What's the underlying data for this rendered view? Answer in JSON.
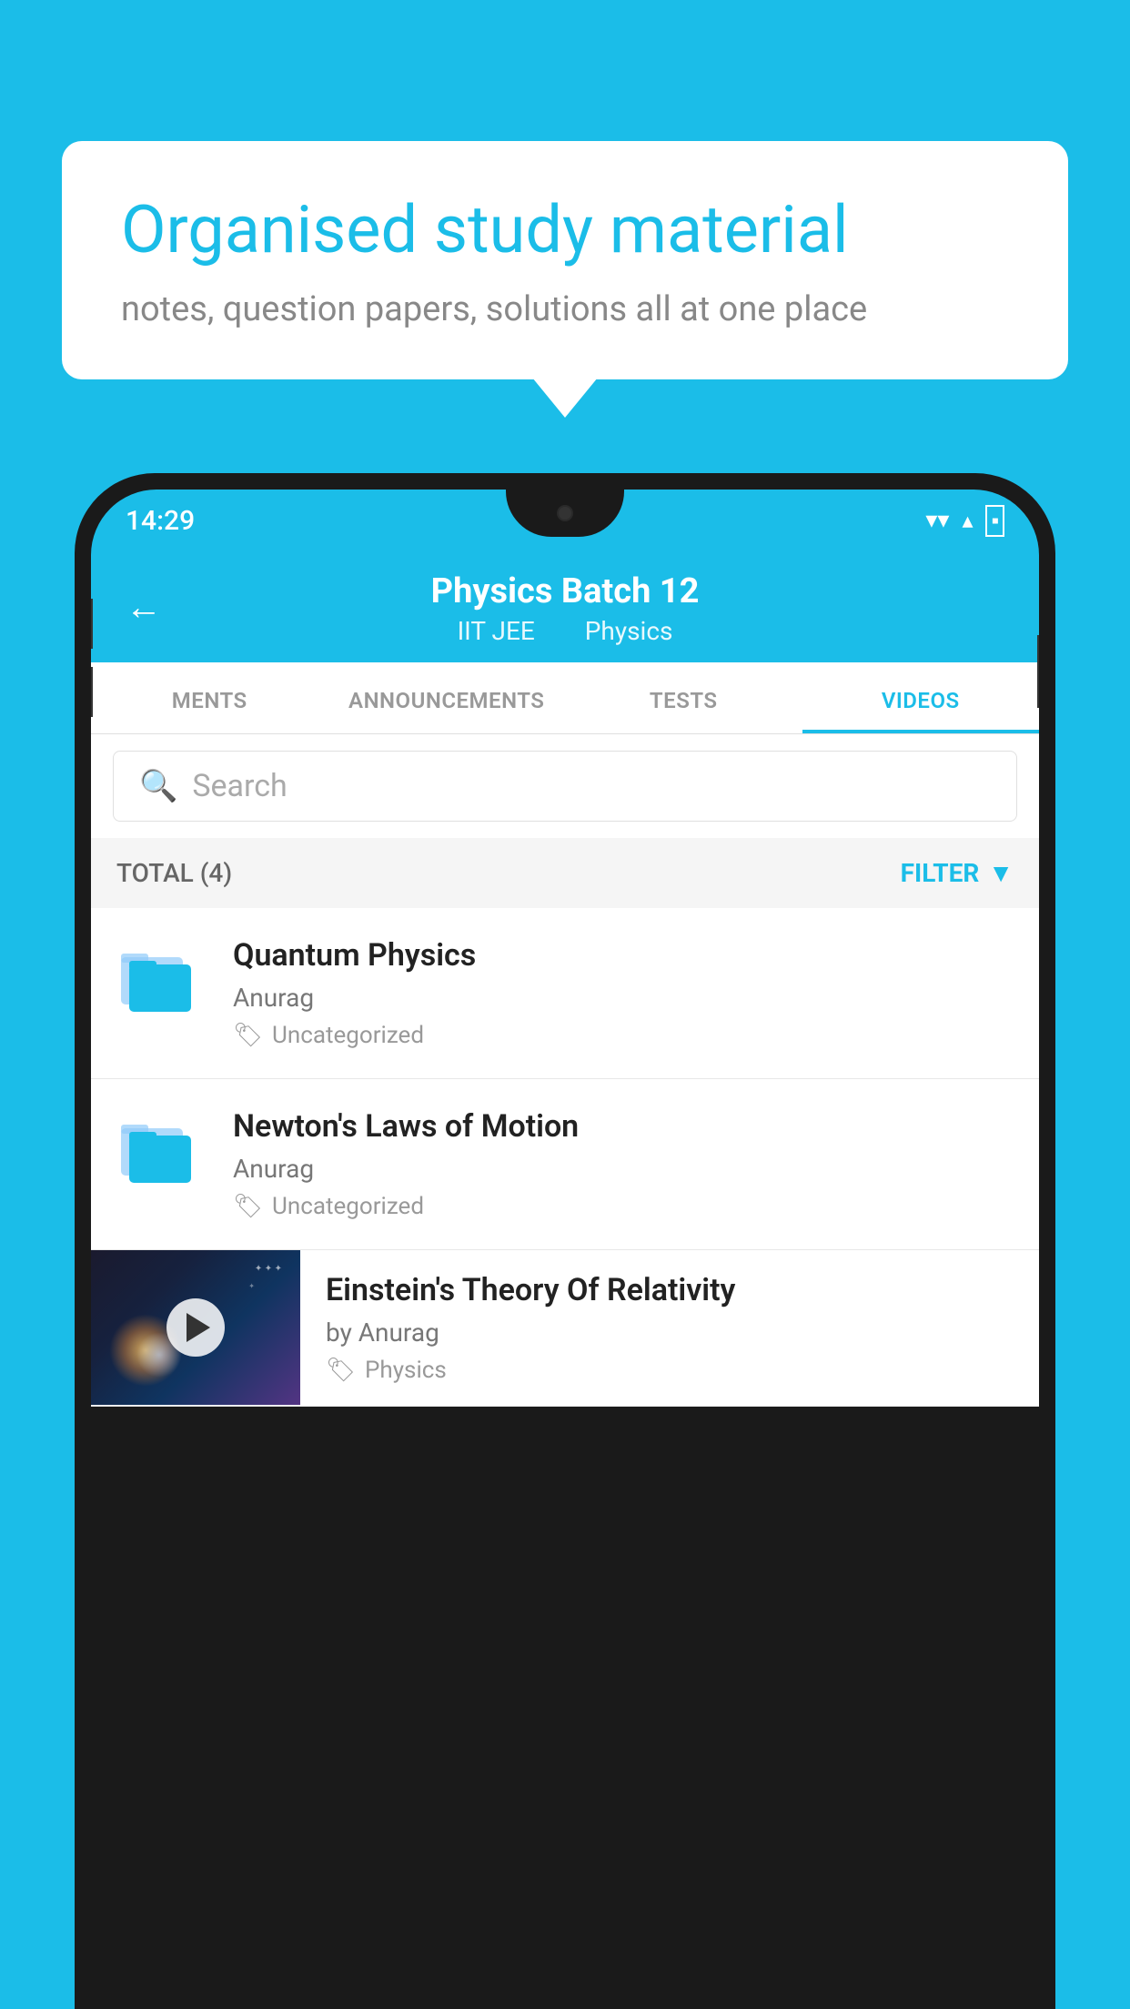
{
  "background_color": "#1BBDE8",
  "speech_bubble": {
    "title": "Organised study material",
    "subtitle": "notes, question papers, solutions all at one place"
  },
  "status_bar": {
    "time": "14:29",
    "wifi": "▾",
    "signal": "▴",
    "battery": "▪"
  },
  "header": {
    "title": "Physics Batch 12",
    "subtitle_1": "IIT JEE",
    "subtitle_2": "Physics",
    "back_label": "←"
  },
  "tabs": [
    {
      "id": "ments",
      "label": "MENTS",
      "active": false
    },
    {
      "id": "announcements",
      "label": "ANNOUNCEMENTS",
      "active": false
    },
    {
      "id": "tests",
      "label": "TESTS",
      "active": false
    },
    {
      "id": "videos",
      "label": "VIDEOS",
      "active": true
    }
  ],
  "search": {
    "placeholder": "Search"
  },
  "filter_bar": {
    "total_label": "TOTAL (4)",
    "filter_label": "FILTER"
  },
  "videos": [
    {
      "id": 1,
      "title": "Quantum Physics",
      "author": "Anurag",
      "tag": "Uncategorized",
      "has_thumbnail": false
    },
    {
      "id": 2,
      "title": "Newton's Laws of Motion",
      "author": "Anurag",
      "tag": "Uncategorized",
      "has_thumbnail": false
    },
    {
      "id": 3,
      "title": "Einstein's Theory Of Relativity",
      "author": "by Anurag",
      "tag": "Physics",
      "has_thumbnail": true
    }
  ]
}
